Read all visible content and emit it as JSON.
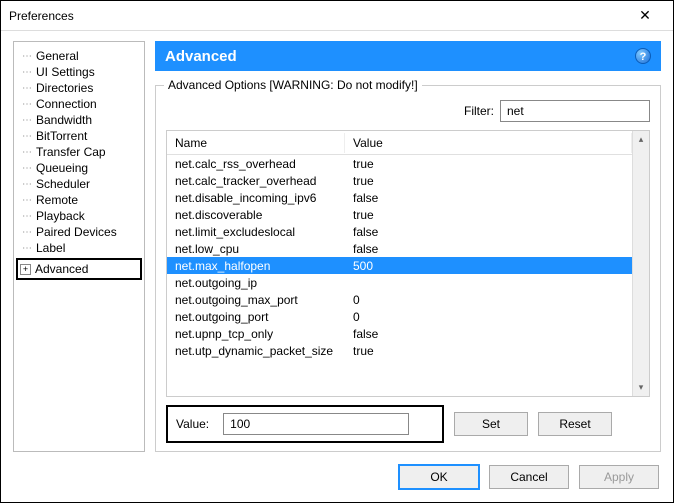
{
  "window": {
    "title": "Preferences"
  },
  "sidebar": {
    "items": [
      "General",
      "UI Settings",
      "Directories",
      "Connection",
      "Bandwidth",
      "BitTorrent",
      "Transfer Cap",
      "Queueing",
      "Scheduler",
      "Remote",
      "Playback",
      "Paired Devices",
      "Label"
    ],
    "advanced": "Advanced"
  },
  "header": {
    "title": "Advanced"
  },
  "group": {
    "label": "Advanced Options [WARNING: Do not modify!]",
    "filter_label": "Filter:",
    "filter_value": "net",
    "columns": {
      "name": "Name",
      "value": "Value"
    },
    "rows": [
      {
        "name": "net.calc_rss_overhead",
        "value": "true",
        "selected": false
      },
      {
        "name": "net.calc_tracker_overhead",
        "value": "true",
        "selected": false
      },
      {
        "name": "net.disable_incoming_ipv6",
        "value": "false",
        "selected": false
      },
      {
        "name": "net.discoverable",
        "value": "true",
        "selected": false
      },
      {
        "name": "net.limit_excludeslocal",
        "value": "false",
        "selected": false
      },
      {
        "name": "net.low_cpu",
        "value": "false",
        "selected": false
      },
      {
        "name": "net.max_halfopen",
        "value": "500",
        "selected": true
      },
      {
        "name": "net.outgoing_ip",
        "value": "",
        "selected": false
      },
      {
        "name": "net.outgoing_max_port",
        "value": "0",
        "selected": false
      },
      {
        "name": "net.outgoing_port",
        "value": "0",
        "selected": false
      },
      {
        "name": "net.upnp_tcp_only",
        "value": "false",
        "selected": false
      },
      {
        "name": "net.utp_dynamic_packet_size",
        "value": "true",
        "selected": false
      }
    ],
    "value_label": "Value:",
    "value_input": "100",
    "set_label": "Set",
    "reset_label": "Reset"
  },
  "buttons": {
    "ok": "OK",
    "cancel": "Cancel",
    "apply": "Apply"
  }
}
